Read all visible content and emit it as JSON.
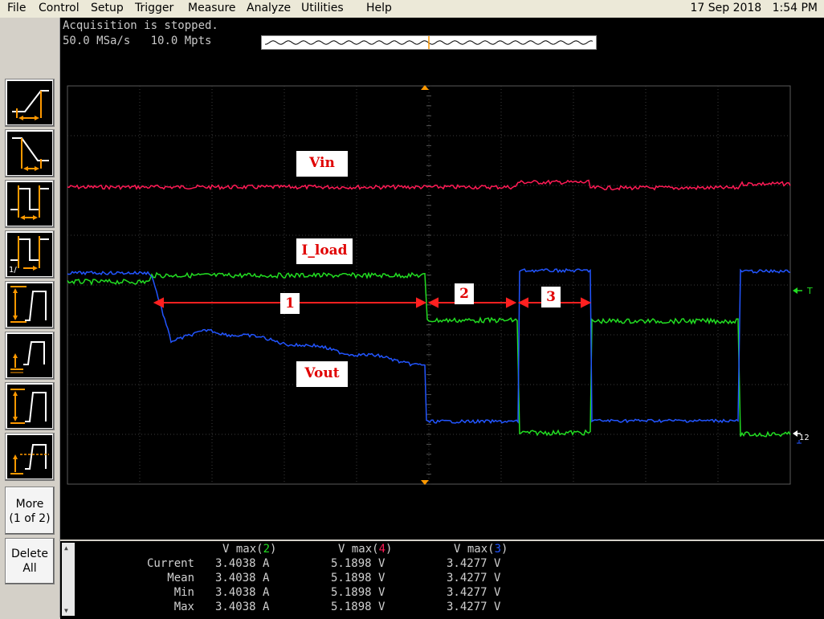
{
  "menubar": {
    "items": [
      "File",
      "Control",
      "Setup",
      "Trigger",
      "Measure",
      "Analyze",
      "Utilities",
      "Help"
    ],
    "date": "17 Sep 2018",
    "time": "1:54 PM"
  },
  "status": {
    "acquisition": "Acquisition is stopped.",
    "sample_rate": "50.0 MSa/s",
    "memory_depth": "10.0 Mpts"
  },
  "sidepanel": {
    "more_line1": "More",
    "more_line2": "(1 of 2)",
    "delete_line1": "Delete",
    "delete_line2": "All"
  },
  "annotations": {
    "vin": "Vin",
    "iload": "I_load",
    "vout": "Vout",
    "region1": "1",
    "region2": "2",
    "region3": "3"
  },
  "markers": {
    "trigger_label": "T",
    "ground_label": "12"
  },
  "colors": {
    "ch2_current": "#22dd22",
    "ch4_vin": "#ff1a55",
    "ch3_vout": "#2255ff",
    "annotation_arrow": "#ff2020",
    "marker_orange": "#ff9900"
  },
  "measurements": {
    "headers": [
      {
        "label": "V max(",
        "channel": "2",
        "color": "#22dd22"
      },
      {
        "label": "V max(",
        "channel": "4",
        "color": "#ff1a55"
      },
      {
        "label": "V max(",
        "channel": "3",
        "color": "#2255ff"
      }
    ],
    "rows": [
      {
        "name": "Current",
        "values": [
          "3.4038 A",
          "5.1898 V",
          "3.4277 V"
        ]
      },
      {
        "name": "Mean",
        "values": [
          "3.4038 A",
          "5.1898 V",
          "3.4277 V"
        ]
      },
      {
        "name": "Min",
        "values": [
          "3.4038 A",
          "5.1898 V",
          "3.4277 V"
        ]
      },
      {
        "name": "Max",
        "values": [
          "3.4038 A",
          "5.1898 V",
          "3.4277 V"
        ]
      }
    ]
  }
}
